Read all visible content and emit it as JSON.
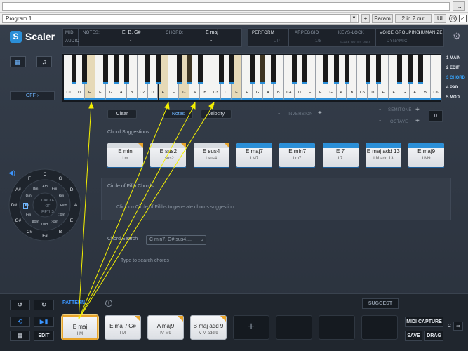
{
  "host": {
    "menu_btn": "...",
    "program": "Program 1",
    "plus": "+",
    "param": "Param",
    "io": "2 in 2 out",
    "ui": "UI"
  },
  "app": {
    "logo": "Scaler",
    "status": {
      "midi": "MIDI",
      "audio": "AUDIO",
      "notes_label": "NOTES:",
      "notes_value": "E, B, G#",
      "chord_label": "CHORD:",
      "chord_value": "E maj",
      "dash1": "-",
      "dash2": "-"
    },
    "modes": {
      "perform": "PERFORM",
      "arpeggio": "ARPEGGIO",
      "keys_lock": "KEYS-LOCK",
      "voice_grouping": "VOICE GROUPING",
      "humanize": "HUMANIZE",
      "up": "UP",
      "rate": "1/8",
      "keys_sub": "SCALE NOTES ONLY",
      "dynamic": "DYNAMIC"
    },
    "off": "OFF",
    "nav": [
      "1 MAIN",
      "2 EDIT",
      "3 CHORD",
      "4 PAD",
      "5 MOD"
    ],
    "keys": [
      "C1",
      "D",
      "E",
      "F",
      "G",
      "A",
      "B",
      "C2",
      "D",
      "E",
      "F",
      "G",
      "A",
      "B",
      "C3",
      "D",
      "E",
      "F",
      "G",
      "A",
      "B",
      "C4",
      "D",
      "E",
      "F",
      "G",
      "A",
      "B",
      "C5",
      "D",
      "E",
      "F",
      "G",
      "A",
      "B",
      "C6"
    ],
    "controls": {
      "clear": "Clear",
      "notes": "Notes",
      "velocity": "Velocity",
      "inversion": "INVERSION",
      "minus": "-",
      "plus": "+",
      "semitone": "SEMITONE",
      "octave": "OCTAVE",
      "value": "0"
    },
    "suggestions_title": "Chord Suggestions",
    "suggestions": [
      {
        "name": "E min",
        "roman": "i m"
      },
      {
        "name": "E sus2",
        "roman": "I sus2"
      },
      {
        "name": "E sus4",
        "roman": "I sus4"
      },
      {
        "name": "E maj7",
        "roman": "I M7"
      },
      {
        "name": "E min7",
        "roman": "i m7"
      },
      {
        "name": "E 7",
        "roman": "I 7"
      },
      {
        "name": "E maj add 13",
        "roman": "I M add 13"
      },
      {
        "name": "E maj9",
        "roman": "I M9"
      }
    ],
    "circle": {
      "outer": [
        "C",
        "G",
        "D",
        "A",
        "E",
        "B",
        "F#",
        "C#",
        "G#",
        "D#",
        "A#",
        "F"
      ],
      "inner": [
        "Am",
        "Em",
        "Bm",
        "F#m",
        "C#m",
        "G#m",
        "D#m",
        "A#m",
        "Fm",
        "Cm",
        "Gm",
        "Dm"
      ],
      "center1": "CIRCLE",
      "center2": "OF",
      "center3": "FIFTHS"
    },
    "circle_panel": {
      "title": "Circle of Fifth Chords",
      "hint": "Click on Circle of Fifths to generate chords suggestion"
    },
    "search_panel": {
      "title": "Chord Search",
      "placeholder": "C min7, G# sus4,...",
      "hint": "Type to search chords"
    },
    "bottom": {
      "pattern": "PATTERN",
      "suggest": "SUGGEST",
      "edit": "EDIT",
      "midi_capture": "MIDI CAPTURE",
      "save": "SAVE",
      "drag": "DRAG",
      "c": "C",
      "add": "+",
      "chords": [
        {
          "name": "E maj",
          "roman": "I M"
        },
        {
          "name": "E maj / G#",
          "roman": "I M"
        },
        {
          "name": "A maj9",
          "roman": "IV M9"
        },
        {
          "name": "B maj add 9",
          "roman": "V M add 9"
        }
      ]
    }
  }
}
